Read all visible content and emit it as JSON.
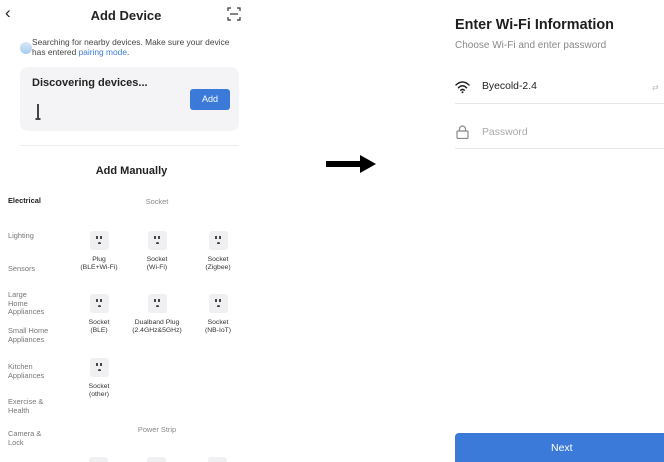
{
  "left": {
    "header": {
      "back_icon": "chevron-left-icon",
      "title": "Add Device",
      "scan_icon": "scan-icon"
    },
    "search_status": {
      "text": "Searching for nearby devices. Make sure your device has entered",
      "link": "pairing mode",
      "suffix": "."
    },
    "discovering": {
      "title": "Discovering devices...",
      "add_label": "Add"
    },
    "manual": {
      "title": "Add Manually",
      "categories": [
        "Electrical",
        "Lighting",
        "Sensors",
        "Large Home Appliances",
        "Small Home Appliances",
        "Kitchen Appliances",
        "Exercise & Health",
        "Camera & Lock"
      ],
      "active_category": "Electrical",
      "sections": [
        {
          "title": "Socket",
          "devices": [
            {
              "line1": "Plug",
              "line2": "(BLE+Wi-Fi)"
            },
            {
              "line1": "Socket",
              "line2": "(Wi-Fi)"
            },
            {
              "line1": "Socket",
              "line2": "(Zigbee)"
            },
            {
              "line1": "Socket",
              "line2": "(BLE)"
            },
            {
              "line1": "Dualband Plug",
              "line2": "(2.4GHz&5GHz)"
            },
            {
              "line1": "Socket",
              "line2": "(NB-IoT)"
            },
            {
              "line1": "Socket",
              "line2": "(other)"
            }
          ]
        },
        {
          "title": "Power Strip",
          "devices": []
        }
      ]
    }
  },
  "right": {
    "title": "Enter Wi-Fi Information",
    "subtitle": "Choose Wi-Fi and enter password",
    "ssid": {
      "icon": "wifi-icon",
      "value": "Byecold-2.4",
      "swap_icon": "swap-icon"
    },
    "password": {
      "icon": "lock-icon",
      "placeholder": "Password",
      "value": ""
    },
    "next_label": "Next"
  },
  "colors": {
    "accent": "#3b7ad9",
    "card_bg": "#f4f4f6",
    "arrow": "#000000"
  }
}
